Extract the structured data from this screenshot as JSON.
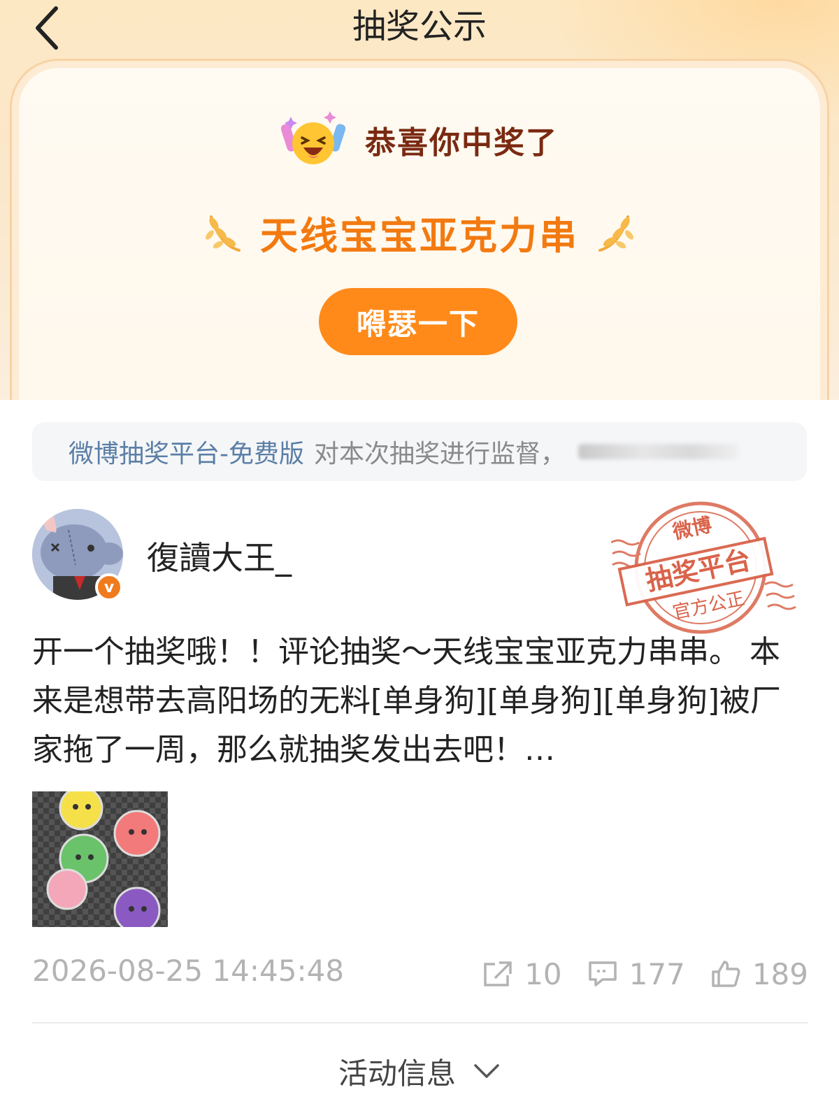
{
  "nav": {
    "title": "抽奖公示"
  },
  "result": {
    "congrats": "恭喜你中奖了",
    "prize_name": "天线宝宝亚克力串",
    "show_button": "嘚瑟一下"
  },
  "notice": {
    "platform_link": "微博抽奖平台-免费版",
    "text": "对本次抽奖进行监督，"
  },
  "post": {
    "username": "復讀大王_",
    "verified_badge": "v",
    "stamp_top": "微博",
    "stamp_middle": "抽奖平台",
    "stamp_bottom": "官方公正",
    "content": "开一个抽奖哦！！评论抽奖～天线宝宝亚克力串串。 本来是想带去高阳场的无料[单身狗][单身狗][单身狗]被厂家拖了一周，那么就抽奖发出去吧！…",
    "timestamp": "2026-08-25 14:45:48",
    "shares": "10",
    "comments": "177",
    "likes": "189"
  },
  "footer": {
    "activity_label": "活动信息"
  },
  "colors": {
    "accent_orange": "#ff8a1a",
    "prize_orange": "#f27a10",
    "congrats_brown": "#7a2a12",
    "link_blue": "#5b7fa6",
    "stamp_red": "#d9634a"
  },
  "icons": [
    "back-arrow-icon",
    "laughing-emoji-icon",
    "laurel-icon",
    "verified-icon",
    "share-icon",
    "comment-icon",
    "like-icon",
    "chevron-down-icon"
  ]
}
